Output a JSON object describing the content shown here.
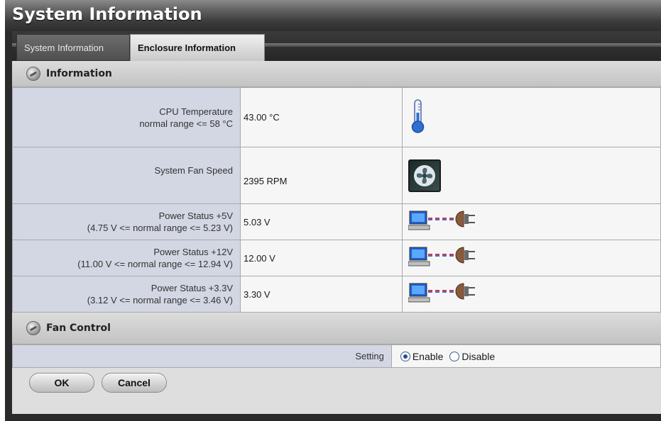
{
  "window": {
    "title": "System Information"
  },
  "tabs": [
    {
      "label": "System Information",
      "active": false
    },
    {
      "label": "Enclosure Information",
      "active": true
    }
  ],
  "information": {
    "section_title": "Information",
    "rows": [
      {
        "label": "CPU Temperature",
        "sublabel": "normal range <= 58 °C",
        "value": "43.00 °C",
        "icon": "thermometer-icon"
      },
      {
        "label": "System Fan Speed",
        "sublabel": "",
        "value": "2395 RPM",
        "icon": "fan-icon"
      },
      {
        "label": "Power Status +5V",
        "sublabel": "(4.75 V <= normal range <= 5.23 V)",
        "value": "5.03 V",
        "icon": "power-plug-icon"
      },
      {
        "label": "Power Status +12V",
        "sublabel": "(11.00 V <= normal range <= 12.94 V)",
        "value": "12.00 V",
        "icon": "power-plug-icon"
      },
      {
        "label": "Power Status +3.3V",
        "sublabel": "(3.12 V <= normal range <= 3.46 V)",
        "value": "3.30 V",
        "icon": "power-plug-icon"
      }
    ]
  },
  "fan_control": {
    "section_title": "Fan Control",
    "setting_label": "Setting",
    "options": [
      {
        "label": "Enable",
        "selected": true
      },
      {
        "label": "Disable",
        "selected": false
      }
    ]
  },
  "buttons": {
    "ok_label": "OK",
    "cancel_label": "Cancel"
  },
  "colors": {
    "accent": "#2a4d8f",
    "label_bg": "#d3d7e3",
    "value_bg": "#f6f6f6",
    "header_bg": "#2e2e2e"
  }
}
